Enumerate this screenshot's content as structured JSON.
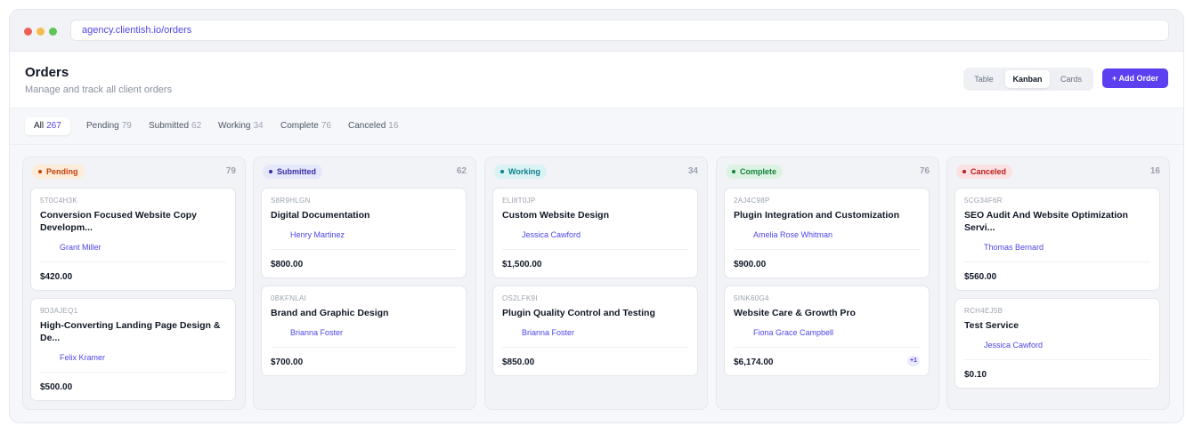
{
  "browser": {
    "url": "agency.clientish.io/orders"
  },
  "header": {
    "title": "Orders",
    "subtitle": "Manage and track all client orders",
    "views": [
      "Table",
      "Kanban",
      "Cards"
    ],
    "active_view": "Kanban",
    "add_button": "+ Add Order"
  },
  "filters": [
    {
      "label": "All",
      "count": "267"
    },
    {
      "label": "Pending",
      "count": "79"
    },
    {
      "label": "Submitted",
      "count": "62"
    },
    {
      "label": "Working",
      "count": "34"
    },
    {
      "label": "Complete",
      "count": "76"
    },
    {
      "label": "Canceled",
      "count": "16"
    }
  ],
  "columns": [
    {
      "status": "Pending",
      "count": "79",
      "color": "#c2410c",
      "bg": "#fdecd9",
      "cards": [
        {
          "code": "5T0C4H3K",
          "title": "Conversion Focused Website Copy Developm...",
          "client": "Grant Miller",
          "price": "$420.00"
        },
        {
          "code": "9D3AJEQ1",
          "title": "High-Converting Landing Page Design & De...",
          "client": "Felix Kramer",
          "price": "$500.00"
        }
      ]
    },
    {
      "status": "Submitted",
      "count": "62",
      "color": "#3730a3",
      "bg": "#e5e7fb",
      "cards": [
        {
          "code": "S8R9HLGN",
          "title": "Digital Documentation",
          "client": "Henry Martinez",
          "price": "$800.00"
        },
        {
          "code": "0BKFNLAI",
          "title": "Brand and Graphic Design",
          "client": "Brianna Foster",
          "price": "$700.00"
        }
      ]
    },
    {
      "status": "Working",
      "count": "34",
      "color": "#0f7f8a",
      "bg": "#d9f2f3",
      "cards": [
        {
          "code": "ELI8T0JP",
          "title": "Custom Website Design",
          "client": "Jessica Cawford",
          "price": "$1,500.00"
        },
        {
          "code": "OS2LFK9I",
          "title": "Plugin Quality Control and Testing",
          "client": "Brianna Foster",
          "price": "$850.00"
        }
      ]
    },
    {
      "status": "Complete",
      "count": "76",
      "color": "#15803d",
      "bg": "#dcf3e3",
      "cards": [
        {
          "code": "2AJ4C98P",
          "title": "Plugin Integration and Customization",
          "client": "Amelia Rose Whitman",
          "price": "$900.00"
        },
        {
          "code": "5INK60G4",
          "title": "Website Care & Growth Pro",
          "client": "Fiona Grace Campbell",
          "price": "$6,174.00",
          "extra": "+1"
        }
      ]
    },
    {
      "status": "Canceled",
      "count": "16",
      "color": "#b91c1c",
      "bg": "#fbe1e1",
      "cards": [
        {
          "code": "5CG34F6R",
          "title": "SEO Audit And Website Optimization Servi...",
          "client": "Thomas Bernard",
          "price": "$560.00"
        },
        {
          "code": "RCH4EJ5B",
          "title": "Test Service",
          "client": "Jessica Cawford",
          "price": "$0.10"
        }
      ]
    }
  ]
}
